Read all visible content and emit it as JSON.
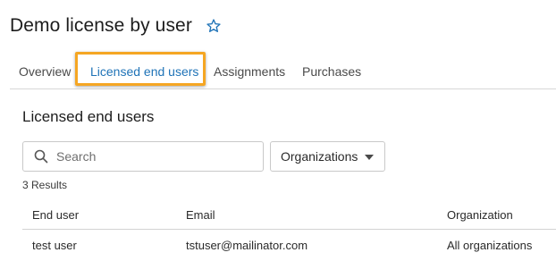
{
  "header": {
    "title": "Demo license by user",
    "favorite_icon": "star-outline-icon",
    "accent_color": "#1f73b7"
  },
  "tabs": [
    {
      "label": "Overview",
      "active": false
    },
    {
      "label": "Licensed end users",
      "active": true
    },
    {
      "label": "Assignments",
      "active": false
    },
    {
      "label": "Purchases",
      "active": false
    }
  ],
  "highlight_color": "#f5a623",
  "section": {
    "title": "Licensed end users"
  },
  "search": {
    "placeholder": "Search",
    "value": "",
    "icon": "search-icon"
  },
  "filter": {
    "selected": "Organizations",
    "icon": "caret-down-icon"
  },
  "results": {
    "text": "3 Results"
  },
  "table": {
    "columns": [
      "End user",
      "Email",
      "Organization"
    ],
    "rows": [
      {
        "end_user": "test user",
        "email": "tstuser@mailinator.com",
        "organization": "All organizations"
      }
    ]
  }
}
